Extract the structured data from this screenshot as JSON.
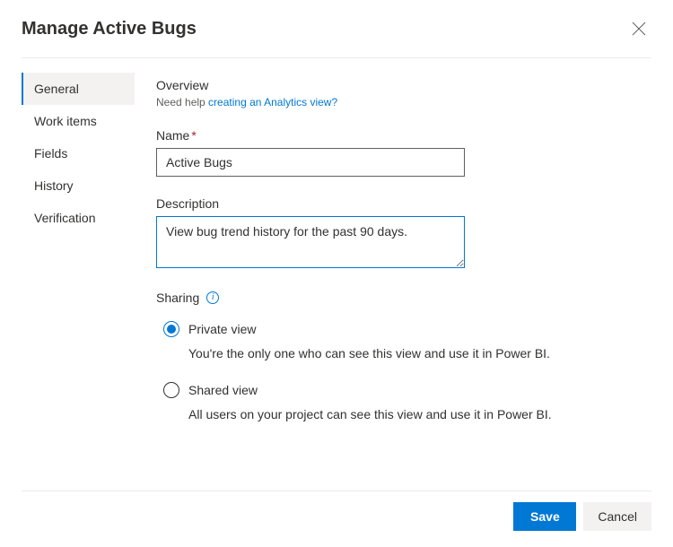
{
  "header": {
    "title": "Manage Active Bugs"
  },
  "sidebar": {
    "items": [
      {
        "label": "General",
        "active": true
      },
      {
        "label": "Work items",
        "active": false
      },
      {
        "label": "Fields",
        "active": false
      },
      {
        "label": "History",
        "active": false
      },
      {
        "label": "Verification",
        "active": false
      }
    ]
  },
  "overview": {
    "title": "Overview",
    "help_prefix": "Need help ",
    "help_link": "creating an Analytics view?"
  },
  "name": {
    "label": "Name",
    "value": "Active Bugs"
  },
  "description": {
    "label": "Description",
    "value": "View bug trend history for the past 90 days."
  },
  "sharing": {
    "label": "Sharing",
    "options": [
      {
        "label": "Private view",
        "desc": "You're the only one who can see this view and use it in Power BI.",
        "selected": true
      },
      {
        "label": "Shared view",
        "desc": "All users on your project can see this view and use it in Power BI.",
        "selected": false
      }
    ]
  },
  "footer": {
    "save": "Save",
    "cancel": "Cancel"
  }
}
